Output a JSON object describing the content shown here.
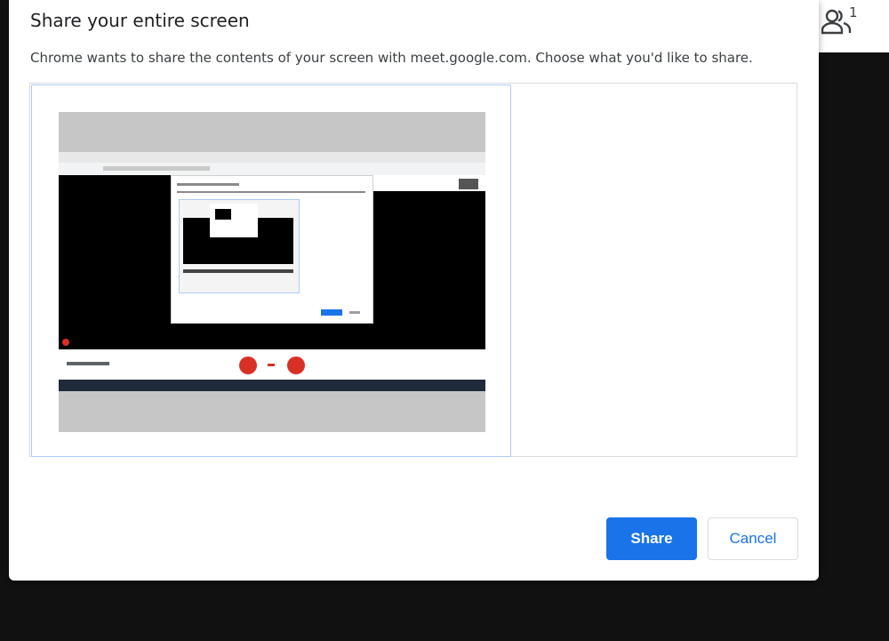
{
  "dialog": {
    "title": "Share your entire screen",
    "description": "Chrome wants to share the contents of your screen with meet.google.com. Choose what you'd like to share.",
    "share_label": "Share",
    "cancel_label": "Cancel"
  },
  "participants": {
    "count": "1",
    "icon": "people-icon"
  },
  "colors": {
    "accent": "#1a73e8",
    "selection_border": "#aecbfa",
    "backdrop": "#111111"
  }
}
